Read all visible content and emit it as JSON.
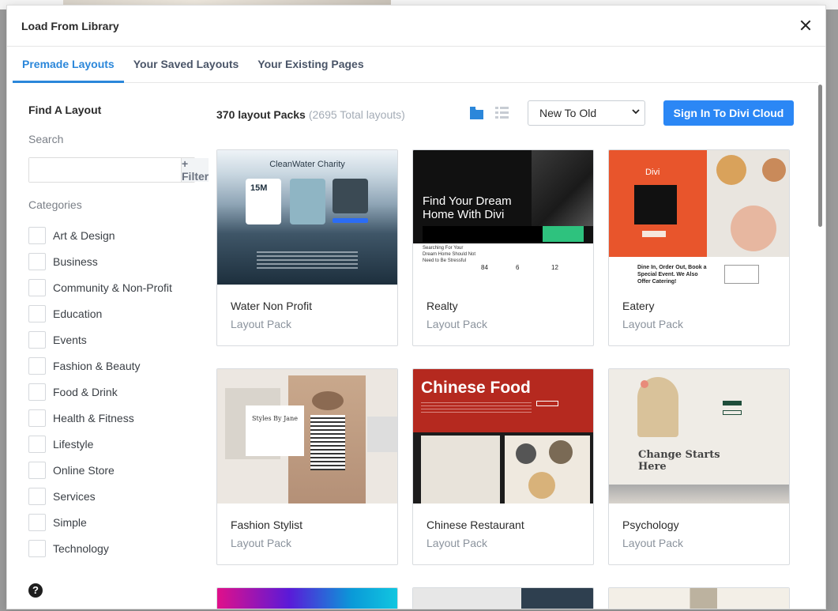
{
  "modal": {
    "title": "Load From Library",
    "tabs": [
      {
        "label": "Premade Layouts",
        "active": true
      },
      {
        "label": "Your Saved Layouts",
        "active": false
      },
      {
        "label": "Your Existing Pages",
        "active": false
      }
    ]
  },
  "sidebar": {
    "heading": "Find A Layout",
    "search_label": "Search",
    "search_value": "",
    "filter_label": "+ Filter",
    "categories_label": "Categories",
    "categories": [
      "Art & Design",
      "Business",
      "Community & Non-Profit",
      "Education",
      "Events",
      "Fashion & Beauty",
      "Food & Drink",
      "Health & Fitness",
      "Lifestyle",
      "Online Store",
      "Services",
      "Simple",
      "Technology"
    ]
  },
  "toolbar": {
    "pack_count": "370 layout Packs",
    "total_layouts": "(2695 Total layouts)",
    "sort_value": "New To Old",
    "cloud_button": "Sign In To Divi Cloud",
    "grid_icon": "grid-view-icon",
    "list_icon": "list-view-icon"
  },
  "layouts": [
    {
      "name": "Water Non Profit",
      "type": "Layout Pack"
    },
    {
      "name": "Realty",
      "type": "Layout Pack"
    },
    {
      "name": "Eatery",
      "type": "Layout Pack"
    },
    {
      "name": "Fashion Stylist",
      "type": "Layout Pack"
    },
    {
      "name": "Chinese Restaurant",
      "type": "Layout Pack"
    },
    {
      "name": "Psychology",
      "type": "Layout Pack"
    }
  ],
  "thumbnails": {
    "water": {
      "title": "CleanWater Charity",
      "stat": "15M"
    },
    "realty": {
      "headline1": "Find Your Dream",
      "headline2": "Home With Divi",
      "sub1": "Searching For Your",
      "sub2": "Dream Home Should Not",
      "sub3": "Need to Be Stressful",
      "n1": "84",
      "n2": "6",
      "n3": "12"
    },
    "eatery": {
      "logo": "Divi",
      "line1": "Dine In, Order Out, Book a",
      "line2": "Special Event. We Also",
      "line3": "Offer Catering!"
    },
    "fashion": {
      "script": "Styles By Jane"
    },
    "chinese": {
      "title": "Chinese Food"
    },
    "psych": {
      "line1": "Change Starts",
      "line2": "Here"
    }
  },
  "help_icon": "?",
  "colors": {
    "accent": "#2b87da",
    "button": "#2b87f5"
  }
}
